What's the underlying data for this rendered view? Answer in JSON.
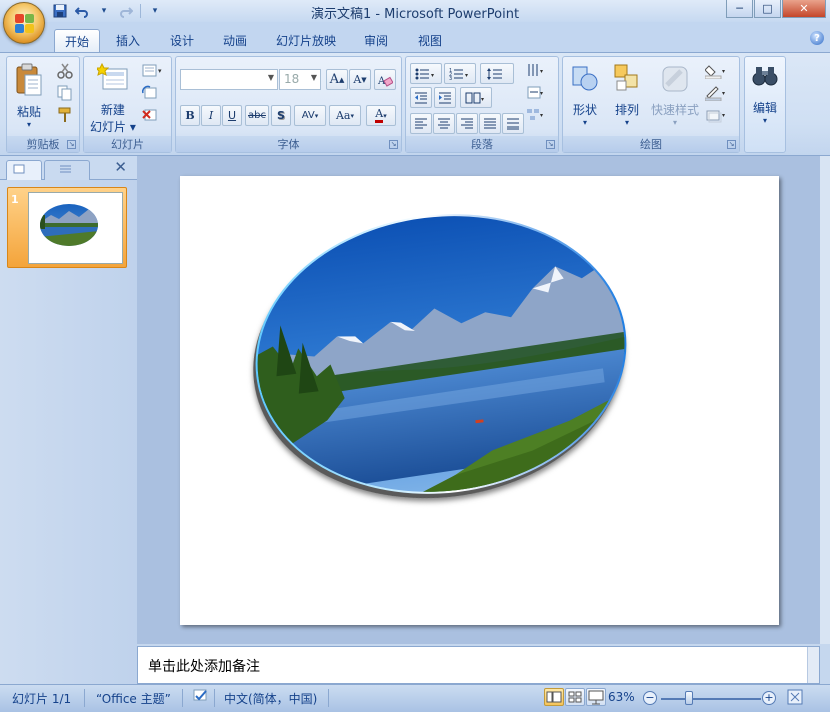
{
  "window": {
    "title": "演示文稿1 - Microsoft PowerPoint",
    "controls": [
      "─",
      "□",
      "✕"
    ]
  },
  "qat": {
    "save": "save-icon",
    "undo": "undo-icon",
    "redo": "redo-icon",
    "customize": "▾"
  },
  "tabs": [
    {
      "label": "开始",
      "active": true
    },
    {
      "label": "插入"
    },
    {
      "label": "设计"
    },
    {
      "label": "动画"
    },
    {
      "label": "幻灯片放映"
    },
    {
      "label": "审阅"
    },
    {
      "label": "视图"
    }
  ],
  "ribbon": {
    "clipboard": {
      "label": "剪贴板",
      "paste": "粘贴"
    },
    "slides": {
      "label": "幻灯片",
      "new_slide_line1": "新建",
      "new_slide_line2": "幻灯片 ▾"
    },
    "font": {
      "label": "字体",
      "font_name": "",
      "font_size": "18",
      "bold": "B",
      "italic": "I",
      "underline": "U",
      "strike": "abc",
      "shadow": "S",
      "spacing": "AV",
      "case": "Aa",
      "color": "A",
      "grow": "A",
      "shrink": "A"
    },
    "paragraph": {
      "label": "段落"
    },
    "drawing": {
      "label": "绘图",
      "shapes": "形状",
      "arrange": "排列",
      "quick_styles": "快速样式"
    },
    "editing": {
      "label": "编辑"
    }
  },
  "slides_pane": {
    "slide_number": "1"
  },
  "notes": {
    "placeholder": "单击此处添加备注"
  },
  "status": {
    "slide_info": "幻灯片 1/1",
    "theme": "“Office 主题”",
    "language": "中文(简体，中国)",
    "zoom": "63%"
  },
  "colors": {
    "accent": "#15428b",
    "ribbon_bg": "#dbe7f6",
    "workspace": "#aac0e0",
    "thumb_highlight": "#f4a43b"
  }
}
